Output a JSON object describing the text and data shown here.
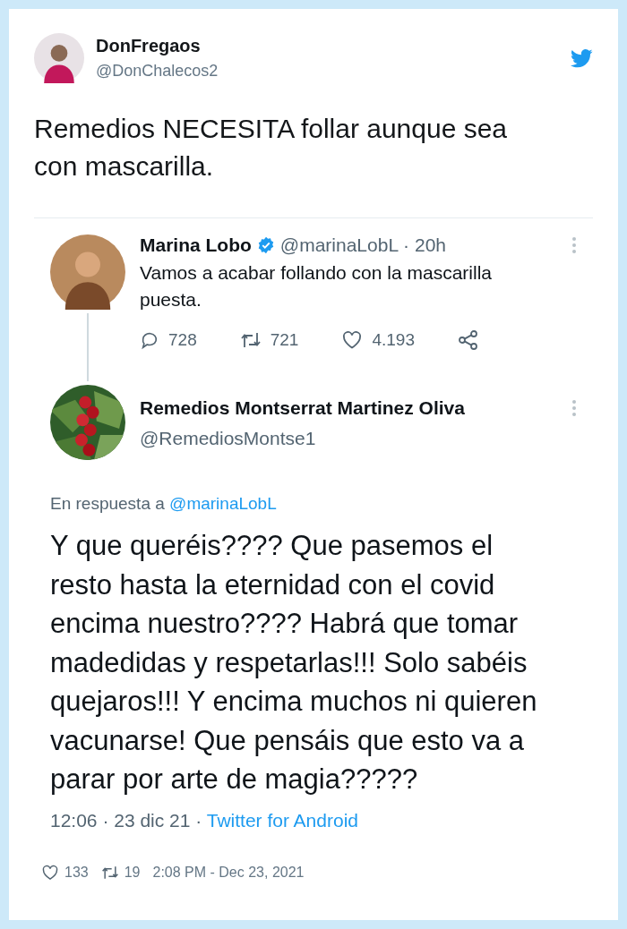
{
  "author": {
    "name": "DonFregaos",
    "handle": "@DonChalecos2"
  },
  "text": "Remedios NECESITA follar aunque sea con mascarilla.",
  "quoted": {
    "parent": {
      "name": "Marina Lobo",
      "verified": true,
      "meta": "@marinaLobL · 20h",
      "text": "Vamos a acabar follando con la mascarilla puesta.",
      "replies": "728",
      "retweets": "721",
      "likes": "4.193"
    },
    "reply": {
      "name": "Remedios Montserrat Martinez Oliva",
      "handle": "@RemediosMontse1",
      "reply_label": "En respuesta a",
      "reply_to": "@marinaLobL",
      "text": "Y que queréis???? Que pasemos el resto hasta la eternidad con el covid encima nuestro???? Habrá que tomar madedidas y respetarlas!!! Solo sabéis quejaros!!! Y encima muchos ni quieren vacunarse! Que pensáis que esto va a parar por arte de magia?????",
      "timestamp": "12:06 · 23 dic 21 ·",
      "source": "Twitter for Android"
    }
  },
  "footer": {
    "likes": "133",
    "retweets": "19",
    "date": "2:08 PM - Dec 23, 2021"
  }
}
